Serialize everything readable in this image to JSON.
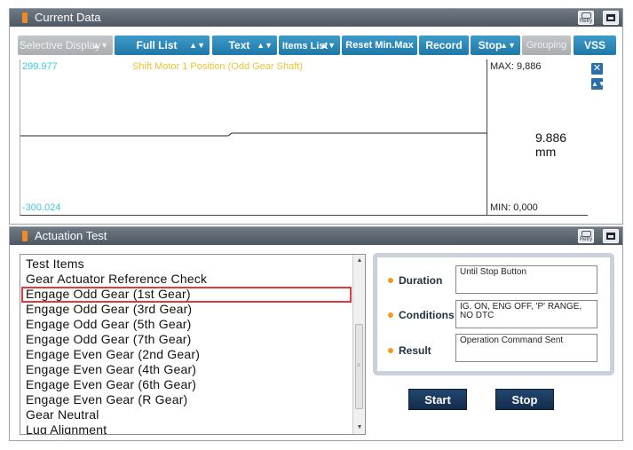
{
  "current_data": {
    "title": "Current Data",
    "retry_label": "Retry",
    "toolbar": {
      "selective_display": "Selective Display",
      "full_list": "Full List",
      "text": "Text",
      "items_list": "Items List",
      "reset_min_max": "Reset Min.Max",
      "record": "Record",
      "stop": "Stop",
      "grouping": "Grouping",
      "vss": "VSS"
    },
    "graph": {
      "y_max": "299.977",
      "y_min": "-300.024",
      "series_name": "Shift Motor 1 Position (Odd Gear Shaft)",
      "max_label": "MAX: 9,886",
      "min_label": "MIN: 0,000",
      "current_value": "9.886 mm"
    }
  },
  "actuation_test": {
    "title": "Actuation Test",
    "retry_label": "Retry",
    "list_header": "Test Items",
    "items": [
      "Gear Actuator Reference Check",
      "Engage Odd Gear (1st Gear)",
      "Engage Odd Gear (3rd Gear)",
      "Engage Odd Gear (5th Gear)",
      "Engage Odd Gear (7th Gear)",
      "Engage Even Gear (2nd Gear)",
      "Engage Even Gear (4th Gear)",
      "Engage Even Gear (6th Gear)",
      "Engage Even Gear (R Gear)",
      "Gear Neutral",
      "Lug Alignment"
    ],
    "selected_index": 1,
    "info": {
      "duration_label": "Duration",
      "duration_value": "Until Stop Button",
      "conditions_label": "Conditions",
      "conditions_value": "IG. ON, ENG OFF, 'P' RANGE, NO DTC",
      "result_label": "Result",
      "result_value": "Operation Command Sent"
    },
    "start_label": "Start",
    "stop_label": "Stop"
  },
  "colors": {
    "accent_orange": "#f08a24",
    "button_blue": "#1f78a8",
    "selection_red": "#e03a3a",
    "action_button_navy": "#142d4d"
  }
}
